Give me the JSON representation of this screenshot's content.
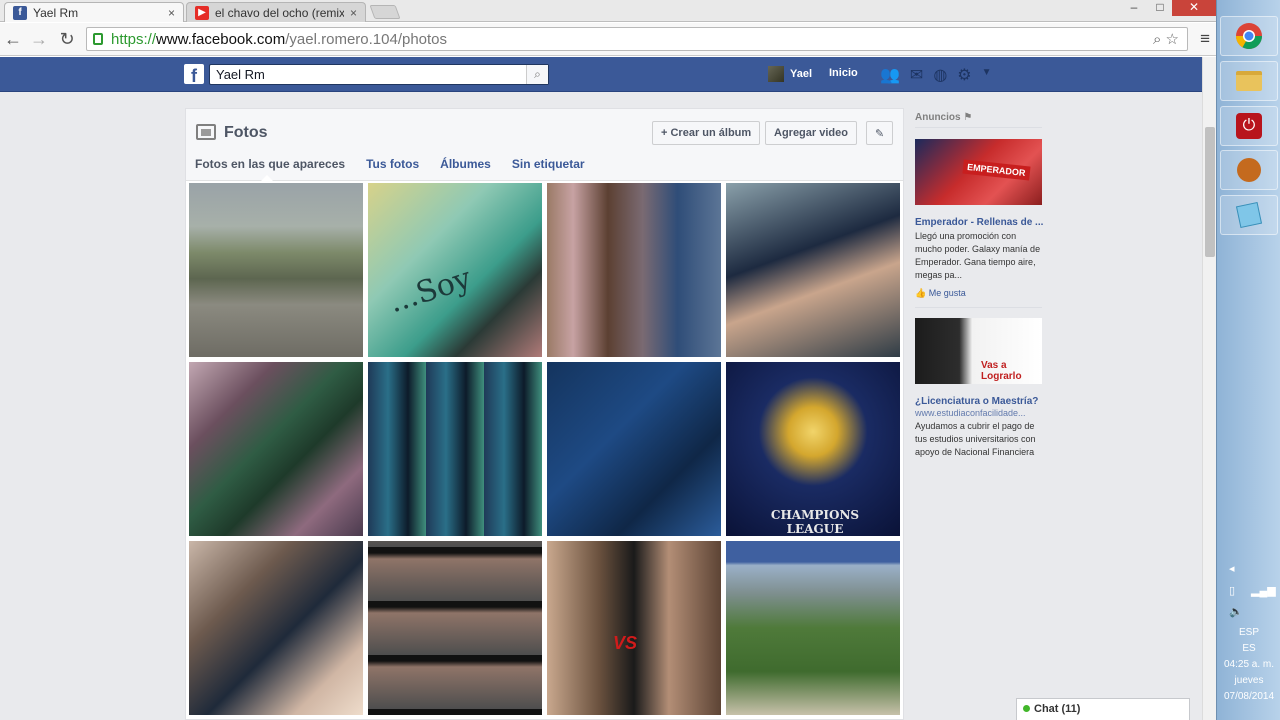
{
  "browser": {
    "tabs": [
      {
        "title": "Yael Rm",
        "close": "×"
      },
      {
        "title": "el chavo del ocho (remix)",
        "close": "×"
      }
    ],
    "url": {
      "scheme": "https://",
      "host": "www.facebook.com",
      "path": "/yael.romero.104/photos"
    },
    "window": {
      "minimize": "‒",
      "maximize": "□",
      "close": "✕"
    }
  },
  "fb": {
    "logo": "f",
    "search_value": "Yael Rm",
    "user_name": "Yael",
    "home_label": "Inicio"
  },
  "photos": {
    "title": "Fotos",
    "create_album": "+ Crear un álbum",
    "add_video": "Agregar video",
    "edit_icon": "✎",
    "tabs": [
      "Fotos en las que apareces",
      "Tus fotos",
      "Álbumes",
      "Sin etiquetar"
    ],
    "overlay_texts": [
      "...Soy",
      "VS",
      "CHAMPIONS LEAGUE"
    ]
  },
  "ads": {
    "header": "Anuncios",
    "items": [
      {
        "title": "Emperador - Rellenas de ...",
        "body": "Llegó una promoción con mucho poder. Galaxy manía de Emperador. Gana tiempo aire, megas pa...",
        "like": "Me gusta",
        "image_text": "EMPERADOR"
      },
      {
        "title": "¿Licenciatura o Maestría?",
        "url": "www.estudiaconfacilidade...",
        "body": "Ayudamos a cubrir el pago de tus estudios universitarios con apoyo de Nacional Financiera",
        "image_text": "Vas a Lograrlo"
      }
    ]
  },
  "chat": {
    "label": "Chat (11)"
  },
  "tray": {
    "lang1": "ESP",
    "lang2": "ES",
    "time": "04:25 a. m.",
    "day": "jueves",
    "date": "07/08/2014"
  },
  "colors": {
    "fb_blue": "#3b5998",
    "link": "#3b5998",
    "page_bg": "#e9eaed"
  }
}
